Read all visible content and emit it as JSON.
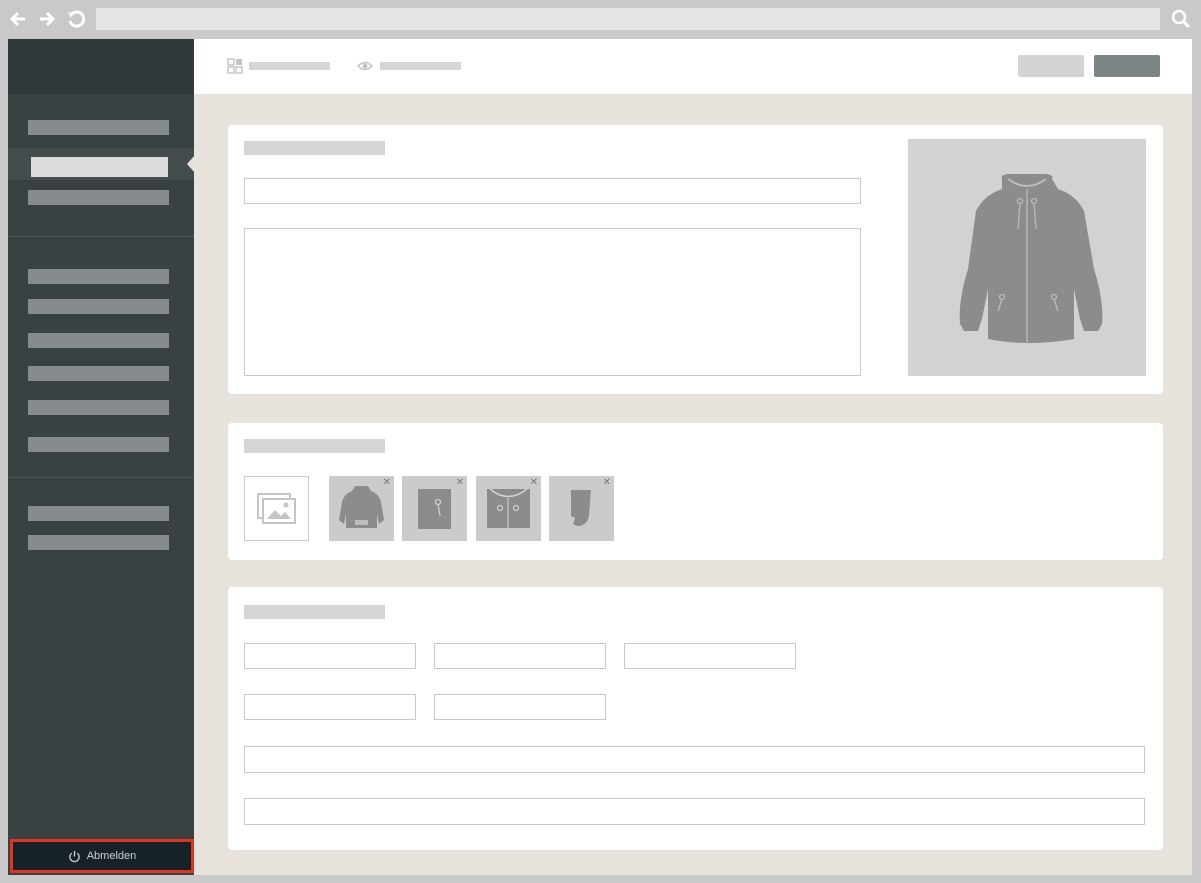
{
  "browser": {
    "back_icon": "arrow-left-icon",
    "forward_icon": "arrow-right-icon",
    "reload_icon": "reload-icon",
    "search_icon": "search-icon",
    "url": ""
  },
  "sidebar": {
    "logout_label": "Abmelden",
    "logout_icon": "power-icon",
    "accent_color": "#e3321f"
  },
  "topbar": {
    "view_icons": [
      "grid-icon",
      "eye-icon"
    ]
  },
  "gallery": {
    "thumb_icons": [
      "jacket-back-icon",
      "pocket-detail-icon",
      "collar-detail-icon",
      "cuff-detail-icon"
    ]
  }
}
